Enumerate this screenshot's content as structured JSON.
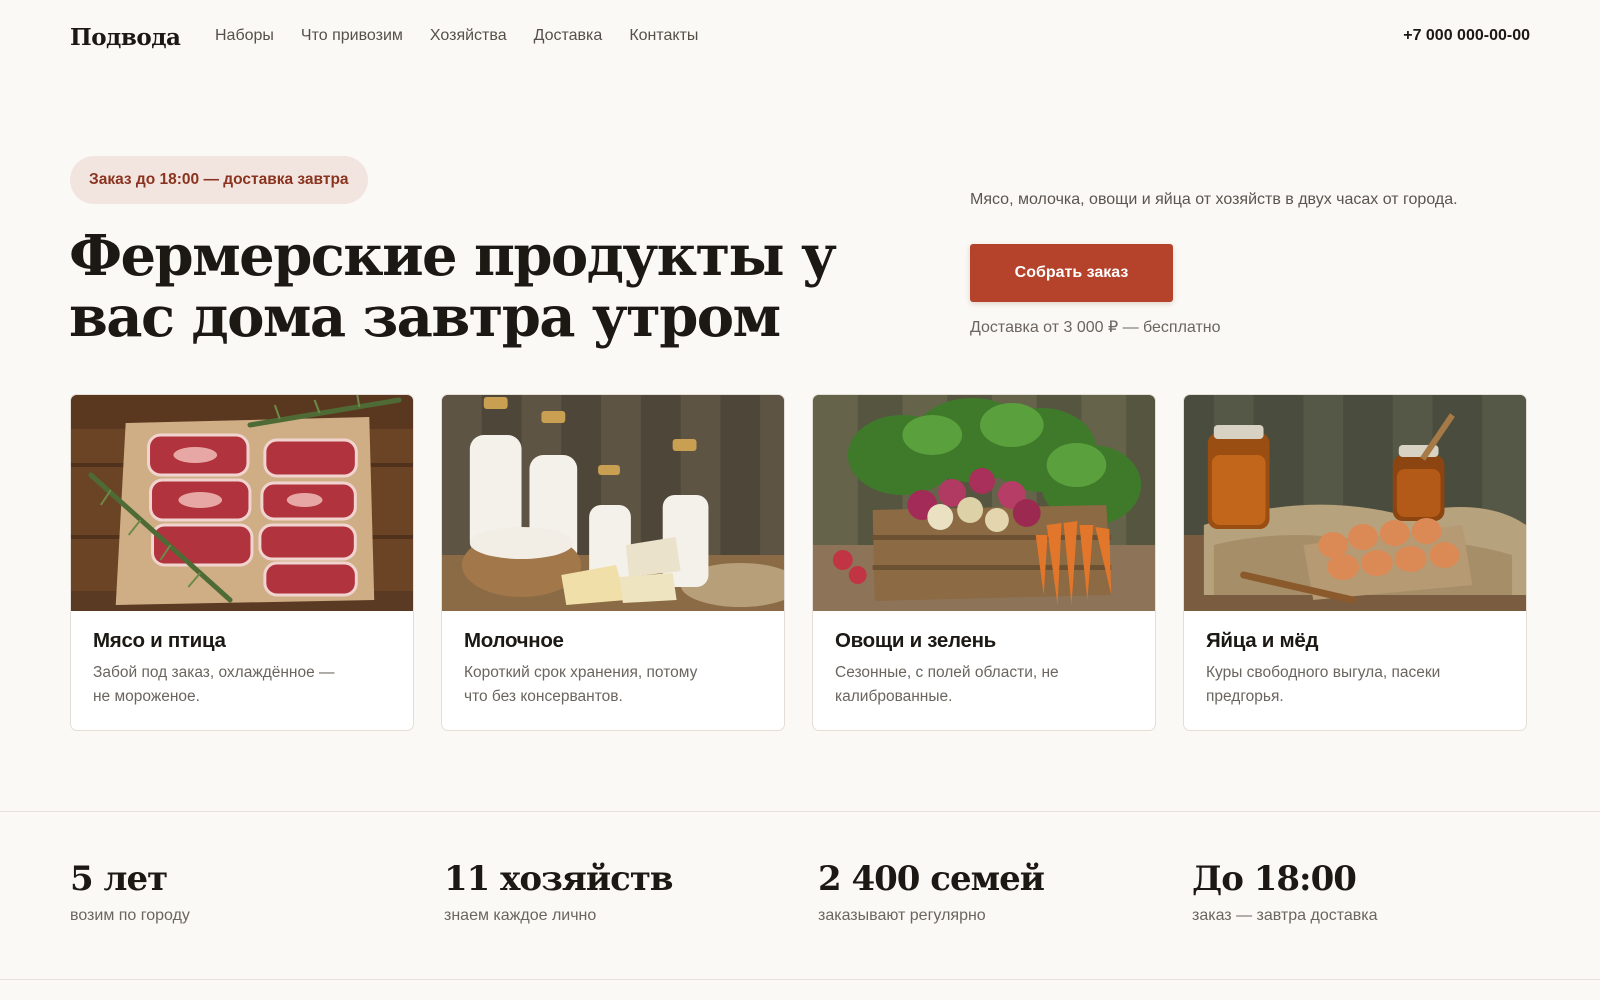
{
  "header": {
    "logo": "Подвода",
    "nav": [
      "Наборы",
      "Что привозим",
      "Хозяйства",
      "Доставка",
      "Контакты"
    ],
    "phone": "+7 000 000-00-00"
  },
  "hero": {
    "badge": "Заказ до 18:00 — доставка завтра",
    "title": "Фермерские продукты у вас дома завтра утром",
    "subtitle": "Мясо, молочка, овощи и яйца от хозяйств в двух часах от города.",
    "cta_label": "Собрать заказ",
    "cta_note": "Доставка от 3 000 ₽ — бесплатно"
  },
  "cards": [
    {
      "title": "Мясо и птица",
      "text": "Забой под заказ, охлаждённое — не мороженое.",
      "image": "meat-photo"
    },
    {
      "title": "Молочное",
      "text": "Короткий срок хранения, потому что без консервантов.",
      "image": "dairy-photo"
    },
    {
      "title": "Овощи и зелень",
      "text": "Сезонные, с полей области, не калиброванные.",
      "image": "vegetables-photo"
    },
    {
      "title": "Яйца и мёд",
      "text": "Куры свободного выгула, пасеки предгорья.",
      "image": "eggs-honey-photo"
    }
  ],
  "stats": [
    {
      "value": "5 лет",
      "label": "возим по городу"
    },
    {
      "value": "11 хозяйств",
      "label": "знаем каждое лично"
    },
    {
      "value": "2 400 семей",
      "label": "заказывают регулярно"
    },
    {
      "value": "До 18:00",
      "label": "заказ — завтра доставка"
    }
  ],
  "colors": {
    "background": "#fbf9f5",
    "accent": "#b5432b",
    "badge_bg": "#f2e5df",
    "badge_text": "#8a3420"
  }
}
